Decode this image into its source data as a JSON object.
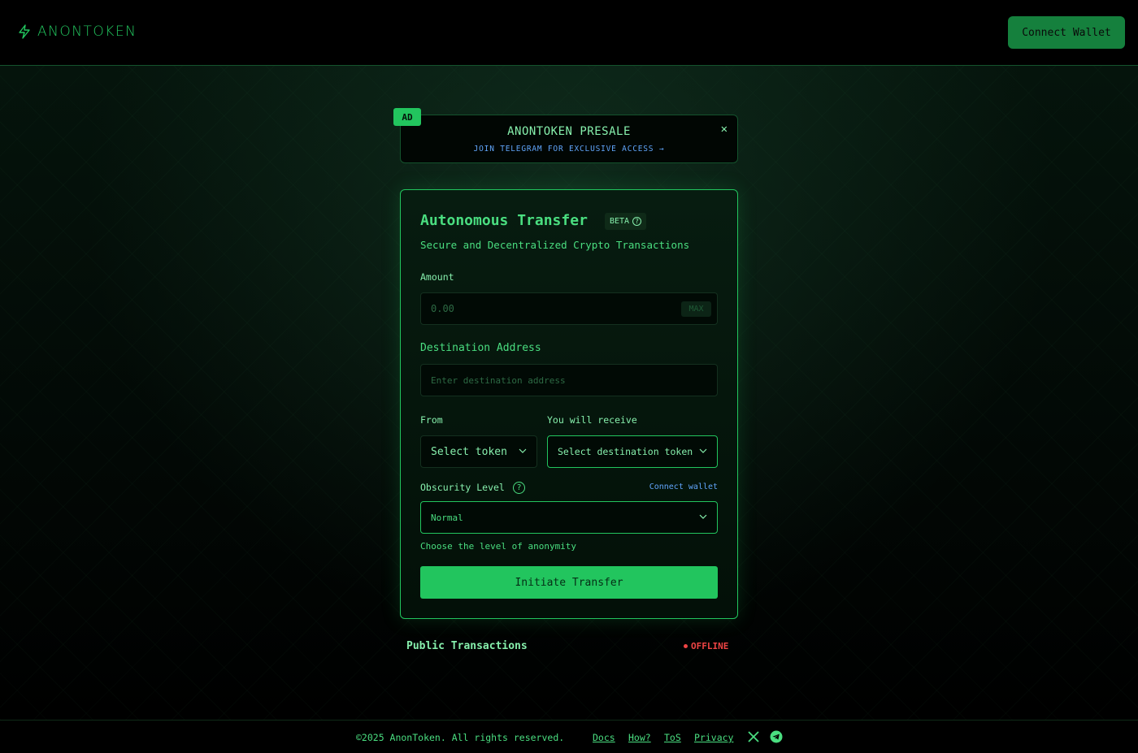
{
  "header": {
    "logo_text": "ANONTOKEN",
    "logo_icon": "lightning-bolt-icon",
    "connect_wallet": "Connect Wallet"
  },
  "ad": {
    "badge": "AD",
    "title": "ANONTOKEN PRESALE",
    "subtitle": "JOIN TELEGRAM FOR EXCLUSIVE ACCESS →",
    "close": "✕"
  },
  "transfer": {
    "title": "Autonomous Transfer",
    "beta": "BETA",
    "subtitle": "Secure and Decentralized Crypto Transactions",
    "amount_label": "Amount",
    "amount_placeholder": "0.00",
    "max_label": "MAX",
    "destination_label": "Destination Address",
    "destination_placeholder": "Enter destination address",
    "from_label": "From",
    "from_value": "Select token",
    "receive_label": "You will receive",
    "receive_value": "Select destination token",
    "obscurity_label": "Obscurity Level",
    "connect_wallet_link": "Connect wallet",
    "obscurity_value": "Normal",
    "hint": "Choose the level of anonymity",
    "submit": "Initiate Transfer"
  },
  "public_tx": {
    "title": "Public Transactions",
    "status": "OFFLINE"
  },
  "footer": {
    "copyright": "©2025 AnonToken. All rights reserved.",
    "links": [
      "Docs",
      "How?",
      "ToS",
      "Privacy"
    ],
    "social": [
      "x-icon",
      "telegram-icon"
    ]
  },
  "colors": {
    "accent": "#22c55e",
    "link": "#60a5fa",
    "offline": "#ef4444"
  }
}
